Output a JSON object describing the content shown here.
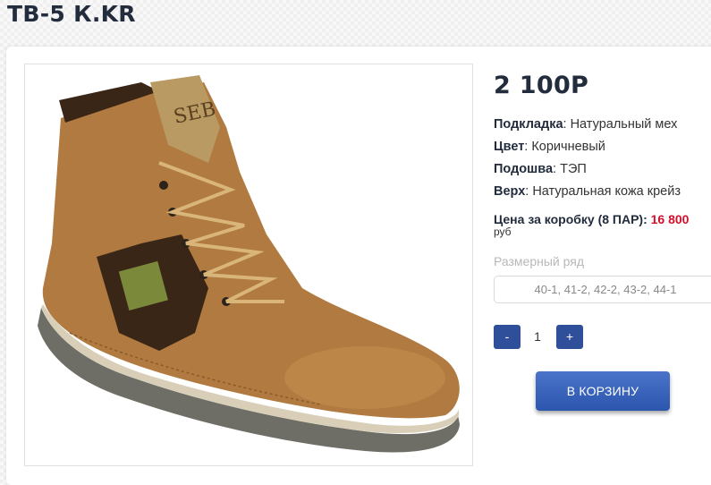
{
  "product": {
    "title": "ТВ-5 К.KR",
    "price": "2 100Р"
  },
  "specs": [
    {
      "label": "Подкладка",
      "value": ": Натуральный мех"
    },
    {
      "label": "Цвет",
      "value": ": Коричневый"
    },
    {
      "label": "Подошва",
      "value": ": ТЭП"
    },
    {
      "label": "Верх",
      "value": ": Натуральная кожа крейз"
    }
  ],
  "box_price": {
    "label": "Цена за коробку (8 ПАР):",
    "value": "16 800",
    "unit": "руб"
  },
  "size": {
    "label": "Размерный ряд",
    "selected": "40-1, 41-2, 42-2, 43-2, 44-1"
  },
  "quantity": {
    "minus": "-",
    "value": "1",
    "plus": "+"
  },
  "cart_button": "В КОРЗИНУ",
  "colors": {
    "title": "#222c3c",
    "accent_red": "#d40f2b",
    "button_blue": "#2f4f9a"
  },
  "icons": {
    "product_image": "boot-photo"
  }
}
